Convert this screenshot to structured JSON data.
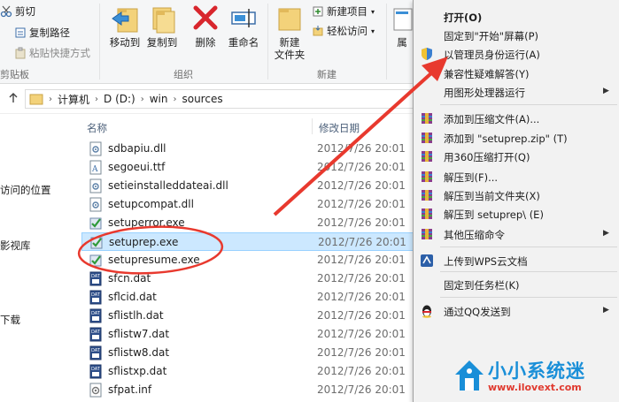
{
  "ribbon": {
    "clipboard": {
      "cut_label": "剪切",
      "copy_path_label": "复制路径",
      "paste_shortcut_label": "粘贴快捷方式",
      "group_label": "剪贴板"
    },
    "organize": {
      "move_to_label": "移动到",
      "copy_to_label": "复制到",
      "delete_label": "删除",
      "rename_label": "重命名",
      "group_label": "组织"
    },
    "new": {
      "new_folder_label": "新建\n文件夹",
      "new_item_label": "新建项目",
      "easy_access_label": "轻松访问",
      "group_label": "新建"
    },
    "properties_partial_label": "属"
  },
  "address": {
    "crumbs": [
      "计算机",
      "D (D:)",
      "win",
      "sources"
    ]
  },
  "nav_pane": {
    "items": [
      "访问的位置",
      "影视库",
      "下载"
    ]
  },
  "file_list": {
    "columns": {
      "name": "名称",
      "date": "修改日期"
    },
    "files": [
      {
        "name": "sdbapiu.dll",
        "date": "2012/7/26 20:01",
        "icon": "dll-icon"
      },
      {
        "name": "segoeui.ttf",
        "date": "2012/7/26 20:01",
        "icon": "font-file-icon"
      },
      {
        "name": "setieinstalleddateai.dll",
        "date": "2012/7/26 20:01",
        "icon": "dll-icon"
      },
      {
        "name": "setupcompat.dll",
        "date": "2012/7/26 20:01",
        "icon": "dll-icon"
      },
      {
        "name": "setuperror.exe",
        "date": "2012/7/26 20:01",
        "icon": "setup-exe-icon"
      },
      {
        "name": "setuprep.exe",
        "date": "2012/7/26 20:01",
        "icon": "setup-exe-icon"
      },
      {
        "name": "setupresume.exe",
        "date": "2012/7/26 20:01",
        "icon": "setup-exe-icon"
      },
      {
        "name": "sfcn.dat",
        "date": "2012/7/26 20:01",
        "icon": "dat-file-icon"
      },
      {
        "name": "sflcid.dat",
        "date": "2012/7/26 20:01",
        "icon": "dat-file-icon"
      },
      {
        "name": "sflistlh.dat",
        "date": "2012/7/26 20:01",
        "icon": "dat-file-icon"
      },
      {
        "name": "sflistw7.dat",
        "date": "2012/7/26 20:01",
        "icon": "dat-file-icon"
      },
      {
        "name": "sflistw8.dat",
        "date": "2012/7/26 20:01",
        "icon": "dat-file-icon"
      },
      {
        "name": "sflistxp.dat",
        "date": "2012/7/26 20:01",
        "icon": "dat-file-icon"
      },
      {
        "name": "sfpat.inf",
        "date": "2012/7/26 20:01",
        "icon": "inf-file-icon"
      }
    ],
    "selected_file": "setuprep.exe"
  },
  "context_menu": {
    "items": [
      {
        "label": "打开(O)",
        "bold": true,
        "icon": "",
        "submenu": false
      },
      {
        "label": "固定到\"开始\"屏幕(P)",
        "icon": "",
        "submenu": false
      },
      {
        "label": "以管理员身份运行(A)",
        "icon": "uac-shield-icon",
        "submenu": false
      },
      {
        "label": "兼容性疑难解答(Y)",
        "icon": "",
        "submenu": false
      },
      {
        "label": "用图形处理器运行",
        "icon": "",
        "submenu": true
      },
      {
        "label": "添加到压缩文件(A)...",
        "icon": "winrar-icon",
        "submenu": false
      },
      {
        "label": "添加到 \"setuprep.zip\" (T)",
        "icon": "winrar-icon",
        "submenu": false
      },
      {
        "label": "用360压缩打开(Q)",
        "icon": "winrar-icon",
        "submenu": false
      },
      {
        "label": "解压到(F)...",
        "icon": "winrar-icon",
        "submenu": false
      },
      {
        "label": "解压到当前文件夹(X)",
        "icon": "winrar-icon",
        "submenu": false
      },
      {
        "label": "解压到 setuprep\\ (E)",
        "icon": "winrar-icon",
        "submenu": false
      },
      {
        "label": "其他压缩命令",
        "icon": "winrar-icon",
        "submenu": true
      },
      {
        "label": "上传到WPS云文档",
        "icon": "wps-cloud-icon",
        "submenu": false
      },
      {
        "label": "固定到任务栏(K)",
        "icon": "",
        "submenu": false
      },
      {
        "label": "通过QQ发送到",
        "icon": "qq-penguin-icon",
        "submenu": true
      }
    ]
  },
  "watermark": {
    "title": "小小系统迷",
    "url": "www.ilovext.com"
  },
  "colors": {
    "selection_bg": "#cce8ff",
    "annotation_red": "#e8392e",
    "watermark_blue": "#1a8fd8",
    "watermark_red": "#e03a2f"
  }
}
